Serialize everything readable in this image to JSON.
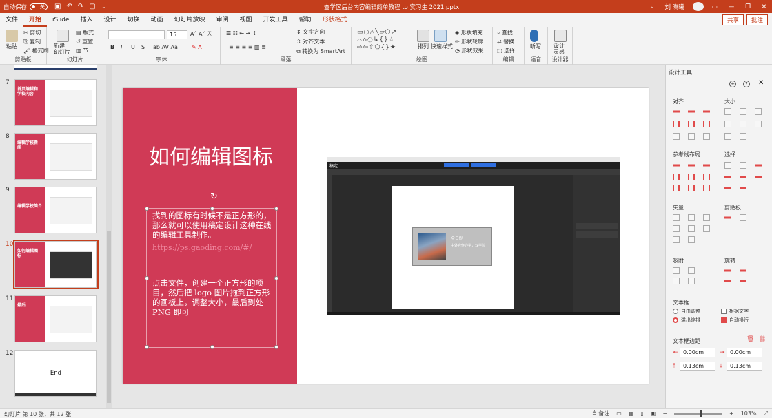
{
  "titlebar": {
    "autosave": "自动保存",
    "toggle": "关",
    "title": "查学区后台内容编辑简单教程 to 实习生 2021.pptx",
    "user": "刘 晓曦"
  },
  "menu": {
    "tabs": [
      "文件",
      "开始",
      "iSlide",
      "插入",
      "设计",
      "切换",
      "动画",
      "幻灯片放映",
      "审阅",
      "视图",
      "开发工具",
      "帮助",
      "形状格式"
    ],
    "share": "共享",
    "comment": "批注"
  },
  "ribbon": {
    "clipboard": {
      "paste": "粘贴",
      "cut": "剪切",
      "copy": "复制",
      "format_painter": "格式刷",
      "label": "剪贴板"
    },
    "slides": {
      "new_slide": "新建\n幻灯片",
      "layout": "版式",
      "reset": "重置",
      "section": "节",
      "label": "幻灯片"
    },
    "font": {
      "size": "15",
      "bold": "B",
      "italic": "I",
      "underline": "U",
      "strike": "S",
      "label": "字体"
    },
    "paragraph": {
      "text_direction": "文字方向",
      "align_text": "对齐文本",
      "smartart": "转换为 SmartArt",
      "label": "段落"
    },
    "drawing": {
      "arrange": "排列",
      "quick_styles": "快速样式",
      "fill": "形状填充",
      "outline": "形状轮廓",
      "effects": "形状效果",
      "label": "绘图"
    },
    "editing": {
      "find": "查找",
      "replace": "替换",
      "select": "选择",
      "label": "编辑"
    },
    "voice": {
      "dictate": "听写",
      "label": "语音"
    },
    "designer": {
      "ideas": "设计\n灵感",
      "label": "设计器"
    }
  },
  "thumbnails": [
    {
      "num": "7",
      "title": "首页编辑和\n学校内容"
    },
    {
      "num": "8",
      "title": "编辑学校新\n闻"
    },
    {
      "num": "9",
      "title": "编辑学校简介"
    },
    {
      "num": "10",
      "title": "如何编辑图\n标"
    },
    {
      "num": "11",
      "title": "最后"
    },
    {
      "num": "12",
      "title": "End"
    }
  ],
  "slide": {
    "title": "如何编辑图标",
    "para1": "找到的图标有时候不是正方形的，那么就可以使用稿定设计这种在线的编辑工具制作。",
    "link": "https://ps.gaoding.com/#/",
    "para2": "点击文件，创建一个正方形的项目，然后把 logo 图片拖到正方形的画板上，调整大小，最后到处 PNG 即可",
    "ps_brand": "稿定",
    "ps_rect_title": "全日制",
    "ps_rect_sub": "中外合作办学，双学位"
  },
  "rightpane": {
    "title": "设计工具",
    "align": "对齐",
    "size": "大小",
    "guides": "参考线布局",
    "select": "选择",
    "vector": "矢量",
    "clipboard": "剪贴板",
    "absorb": "吸附",
    "rotate": "旋转",
    "textbox": "文本框",
    "auto_adjust": "自由调整",
    "fit_text": "根据文字",
    "overflow": "溢出缩排",
    "wrap": "自动换行",
    "margin": "文本框边距",
    "margin_left": "0.00cm",
    "margin_right": "0.00cm",
    "margin_top": "0.13cm",
    "margin_bottom": "0.13cm"
  },
  "status": {
    "slide_info": "幻灯片 第 10 张，共 12 张",
    "notes": "备注",
    "zoom": "103%"
  }
}
